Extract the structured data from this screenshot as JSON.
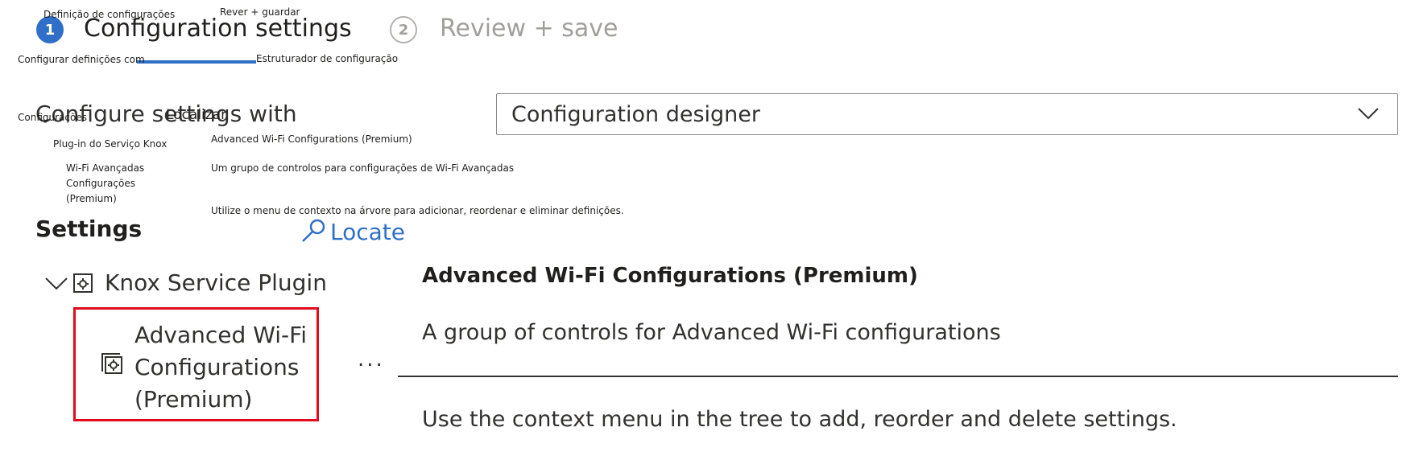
{
  "wizard": {
    "steps": [
      {
        "number": "1",
        "label": "Configuration settings",
        "overlay_label": "Definição de configurações"
      },
      {
        "number": "2",
        "label": "Review + save",
        "overlay_label": "Rever + guardar"
      }
    ]
  },
  "config_with": {
    "label": "Configure settings with",
    "overlay_label": "Configurar definições com",
    "selected": "Configuration designer",
    "overlay_selected": "Estruturador de configuração"
  },
  "settings": {
    "title": "Settings",
    "overlay_title": "Configurações",
    "locate_label": "Locate",
    "overlay_locate": "Localizar",
    "tree": {
      "parent_label": "Knox Service Plugin",
      "overlay_parent": "Plug-in do Serviço Knox",
      "child_label": "Advanced Wi-Fi Configurations (Premium)",
      "overlay_child_lines": [
        "Wi-Fi Avançadas",
        "Configurações",
        "(Premium)"
      ],
      "more_label": "..."
    }
  },
  "details": {
    "title": "Advanced Wi-Fi Configurations (Premium)",
    "overlay_title": "Advanced Wi-Fi Configurations (Premium)",
    "description": "A group of controls for Advanced Wi-Fi configurations",
    "overlay_description": "Um grupo de controlos para configurações de Wi-Fi Avançadas",
    "hint": "Use the context menu in the tree to add, reorder and delete settings.",
    "overlay_hint": "Utilize o menu de contexto na árvore para adicionar, reordenar e eliminar definições."
  },
  "colors": {
    "accent": "#2f6fc8",
    "highlight_border": "#e00b1c",
    "inactive": "#a19f9d"
  },
  "icons": [
    "chevron-down-icon",
    "search-icon",
    "settings-group-icon"
  ]
}
